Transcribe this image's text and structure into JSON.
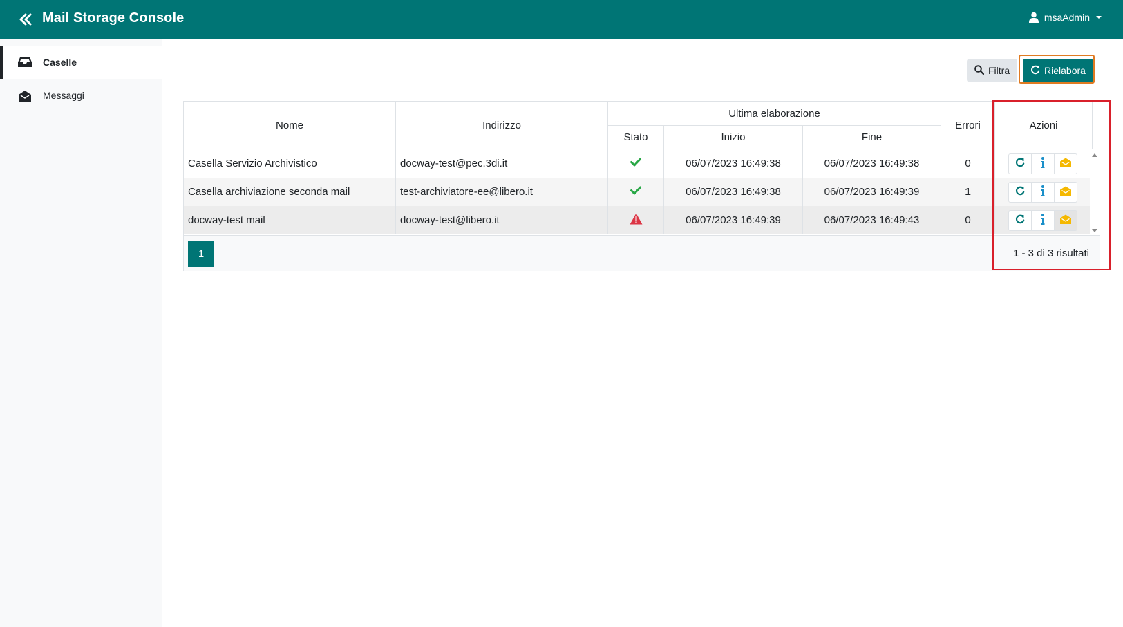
{
  "header": {
    "title": "Mail Storage Console",
    "user": "msaAdmin",
    "bg_color": "#007575"
  },
  "sidebar": {
    "items": [
      {
        "label": "Caselle",
        "icon": "inbox-icon",
        "active": true
      },
      {
        "label": "Messaggi",
        "icon": "envelope-open-icon",
        "active": false
      }
    ]
  },
  "toolbar": {
    "filter_label": "Filtra",
    "reprocess_label": "Rielabora"
  },
  "table": {
    "headers": {
      "nome": "Nome",
      "indirizzo": "Indirizzo",
      "ultima_elaborazione": "Ultima elaborazione",
      "stato": "Stato",
      "inizio": "Inizio",
      "fine": "Fine",
      "errori": "Errori",
      "azioni": "Azioni"
    },
    "rows": [
      {
        "nome": "Casella Servizio Archivistico",
        "indirizzo": "docway-test@pec.3di.it",
        "stato": "ok",
        "inizio": "06/07/2023 16:49:38",
        "fine": "06/07/2023 16:49:38",
        "errori": "0"
      },
      {
        "nome": "Casella archiviazione seconda mail",
        "indirizzo": "test-archiviatore-ee@libero.it",
        "stato": "ok",
        "inizio": "06/07/2023 16:49:38",
        "fine": "06/07/2023 16:49:39",
        "errori": "1"
      },
      {
        "nome": "docway-test mail",
        "indirizzo": "docway-test@libero.it",
        "stato": "warning",
        "inizio": "06/07/2023 16:49:39",
        "fine": "06/07/2023 16:49:43",
        "errori": "0"
      }
    ],
    "pagination": {
      "current_page": "1",
      "results_text": "1 - 3 di 3 risultati"
    }
  },
  "colors": {
    "primary": "#007575",
    "success": "#28a745",
    "danger": "#dc3545",
    "envelope": "#f5b800",
    "highlight_red": "#d9202b",
    "highlight_orange": "#e07b22"
  }
}
